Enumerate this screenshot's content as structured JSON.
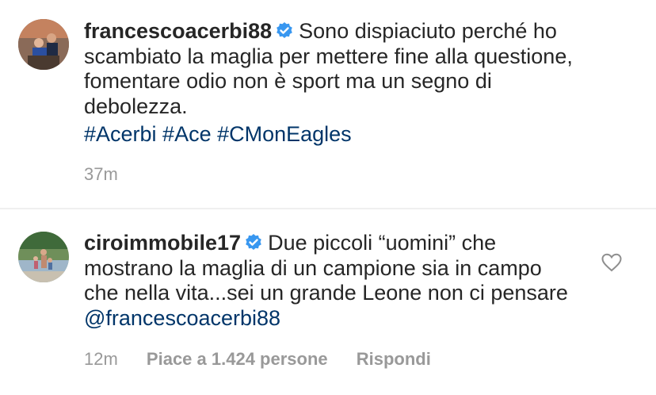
{
  "comments": [
    {
      "username": "francescoacerbi88",
      "text": "Sono dispiaciuto perché ho scambiato la maglia per mettere fine alla questione, fomentare odio non è sport ma un segno di debolezza.",
      "hashtags": "#Acerbi #Ace #CMonEagles",
      "time": "37m"
    },
    {
      "username": "ciroimmobile17",
      "text": "Due piccoli “uomini” che mostrano la maglia di un campione sia in campo che nella vita...sei un grande Leone non ci pensare",
      "mention": "@francescoacerbi88",
      "time": "12m",
      "likes": "Piace a 1.424 persone",
      "reply": "Rispondi"
    }
  ],
  "colors": {
    "link": "#003569",
    "verified": "#3897f0",
    "meta": "#999999"
  },
  "icons": {
    "verified": "verified-badge-icon",
    "like": "heart-icon"
  }
}
